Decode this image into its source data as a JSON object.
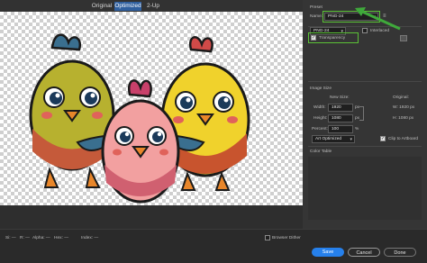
{
  "tabs": [
    {
      "label": "Original"
    },
    {
      "label": "Optimized"
    },
    {
      "label": "2-Up"
    }
  ],
  "preset": {
    "section_label": "Preset",
    "name_label": "Name:",
    "name_value": "PNG-24",
    "format_value": "PNG-24",
    "interlaced_label": "Interlaced",
    "transparency_label": "Transparency"
  },
  "image_size": {
    "section_label": "Image Size",
    "new_size_label": "New Size:",
    "original_label": "Original:",
    "width_label": "Width:",
    "width_value": "1920",
    "height_label": "Height:",
    "height_value": "1080",
    "percent_label": "Percent:",
    "percent_value": "100",
    "unit_px": "px",
    "unit_pct": "%",
    "orig_w": "W:  1920 px",
    "orig_h": "H:  1080 px",
    "quality_value": "Art Optimized",
    "clip_label": "Clip to Artboard"
  },
  "color_table": {
    "label": "Color Table"
  },
  "bottom": {
    "zoom": "Si: —",
    "r": "R: —",
    "alpha": "Alpha: —",
    "hex": "Hex: —",
    "index": "Index: —",
    "browser_dither_label": "Browser Dither",
    "save_label": "Save",
    "cancel_label": "Cancel",
    "done_label": "Done"
  },
  "colors": {
    "accent": "#2680eb",
    "highlight_box": "#5bc236",
    "arrow": "#3fa93b"
  }
}
